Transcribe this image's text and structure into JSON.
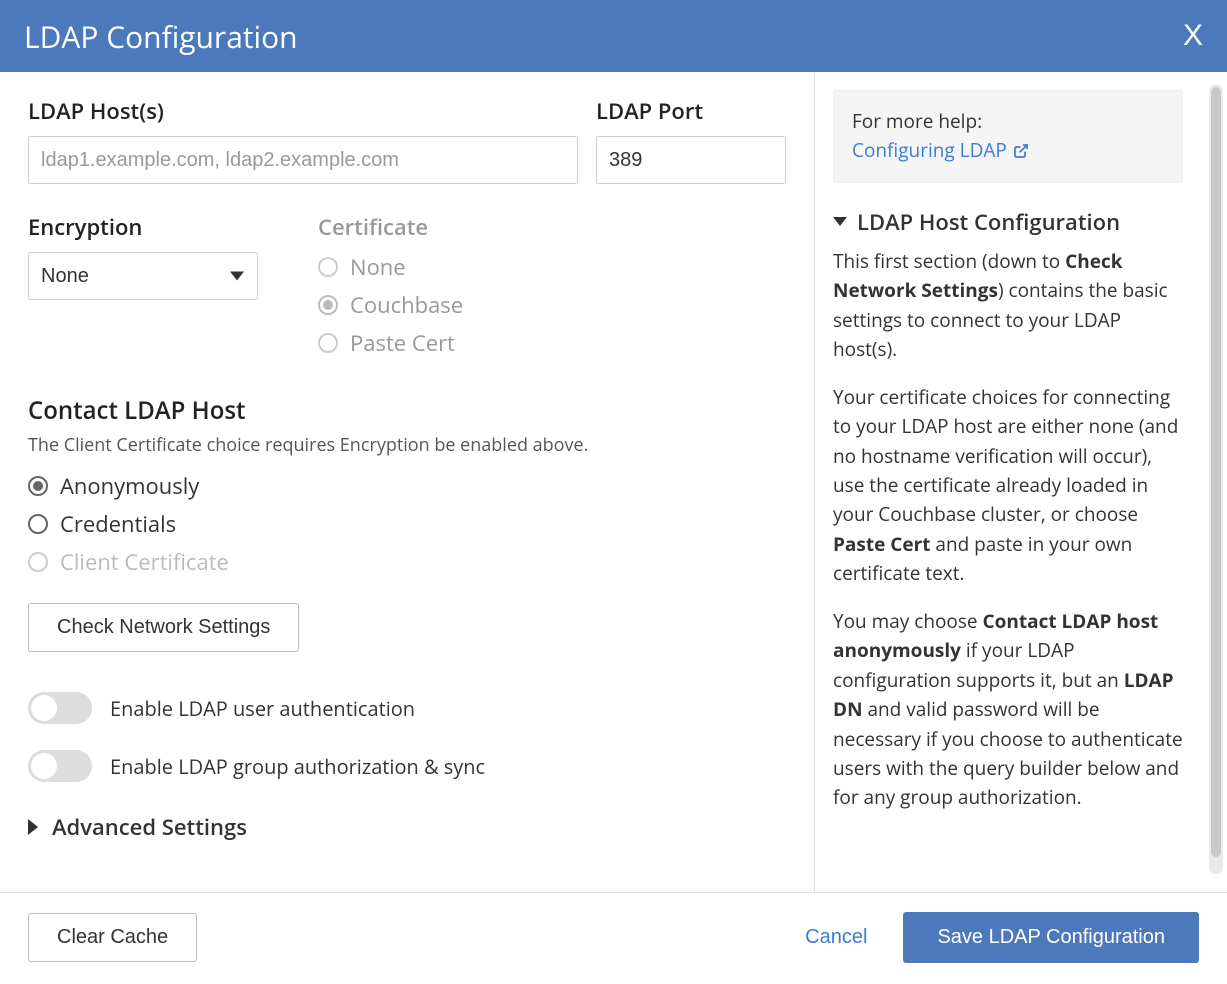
{
  "header": {
    "title": "LDAP Configuration",
    "close": "X"
  },
  "form": {
    "host_label": "LDAP Host(s)",
    "host_placeholder": "ldap1.example.com, ldap2.example.com",
    "port_label": "LDAP Port",
    "port_value": "389",
    "encryption_label": "Encryption",
    "encryption_value": "None",
    "certificate_label": "Certificate",
    "certificate_options": [
      "None",
      "Couchbase",
      "Paste Cert"
    ],
    "contact_heading": "Contact LDAP Host",
    "contact_subtitle": "The Client Certificate choice requires Encryption be enabled above.",
    "contact_options": {
      "anon": "Anonymously",
      "cred": "Credentials",
      "clientcert": "Client Certificate"
    },
    "check_network_btn": "Check Network Settings",
    "toggle_user_auth": "Enable LDAP user authentication",
    "toggle_group_sync": "Enable LDAP group authorization & sync",
    "advanced_settings": "Advanced Settings"
  },
  "help": {
    "more_help_text": "For more help:",
    "more_help_link": "Configuring LDAP",
    "section_title": "LDAP Host Configuration",
    "p1_pre": "This first section (down to ",
    "p1_bold": "Check Network Settings",
    "p1_post": ") contains the basic settings to connect to your LDAP host(s).",
    "p2_pre": "Your certificate choices for connecting to your LDAP host are either none (and no hostname verification will occur), use the certificate already loaded in your Couchbase cluster, or choose ",
    "p2_bold": "Paste Cert",
    "p2_post": " and paste in your own certificate text.",
    "p3_a": "You may choose ",
    "p3_b1": "Contact LDAP host anonymously",
    "p3_b": " if your LDAP configuration supports it, but an ",
    "p3_b2": "LDAP DN",
    "p3_c": " and valid password will be necessary if you choose to authenticate users with the query builder below and for any group authorization."
  },
  "footer": {
    "clear_cache": "Clear Cache",
    "cancel": "Cancel",
    "save": "Save LDAP Configuration"
  }
}
